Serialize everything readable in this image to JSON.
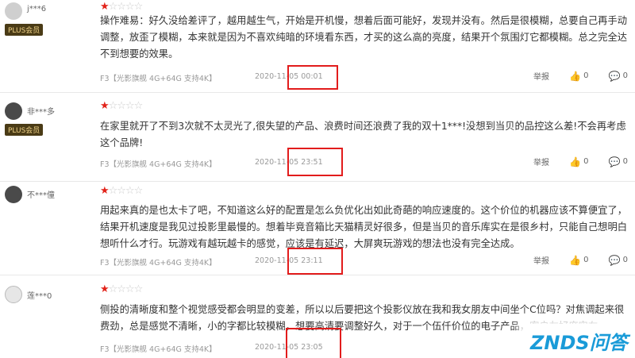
{
  "reviews": [
    {
      "user": "j***6",
      "badge": "PLUS会员",
      "stars_filled": 1,
      "stars_total": 5,
      "content": "操作难易：好久没给差评了，越用越生气，开始是开机慢，想着后面可能好，发现并没有。然后是很模糊，总要自己再手动调整，放歪了模糊，本来就是因为不喜欢纯暗的环境看东西，才买的这么高的亮度，结果开个氛围灯它都模糊。总之完全达不到想要的效果。",
      "product": "F3【光影旗舰 4G+64G 支持4K】",
      "date": "2020-11-05 00:01",
      "report": "举报",
      "likes": "0",
      "replies": "0"
    },
    {
      "user": "非***多",
      "badge": "PLUS会员",
      "stars_filled": 1,
      "stars_total": 5,
      "content": "在家里就开了不到3次就不太灵光了,很失望的产品、浪费时间还浪费了我的双十1***!没想到当贝的品控这么差!不会再考虑这个品牌!",
      "product": "F3【光影旗舰 4G+64G 支持4K】",
      "date": "2020-11-05 23:51",
      "report": "举报",
      "likes": "0",
      "replies": "0"
    },
    {
      "user": "不***僮",
      "badge": "",
      "stars_filled": 1,
      "stars_total": 5,
      "content": "用起来真的是也太卡了吧，不知道这么好的配置是怎么负优化出如此奇葩的响应速度的。这个价位的机器应该不算便宜了，结果开机速度是我见过投影里最慢的。想着毕竟音箱比天猫精灵好很多，但是当贝的音乐库实在是很乡村，只能自己想明白想听什么才行。玩游戏有越玩越卡的感觉，应该是有延迟，大屏爽玩游戏的想法也没有完全达成。",
      "product": "F3【光影旗舰 4G+64G 支持4K】",
      "date": "2020-11-05 23:11",
      "report": "举报",
      "likes": "0",
      "replies": "0"
    },
    {
      "user": "莲***0",
      "badge": "",
      "stars_filled": 1,
      "stars_total": 5,
      "content": "侧投的清晰度和整个视觉感受都会明显的变差，所以以后要把这个投影仪放在我和我女朋友中间坐个C位吗？对焦调起来很费劲，总是感觉不清晰，小的字都比较模糊，想要高清要调整好久，对于一个伍仟价位的电子产品，客户友好度实在",
      "product": "F3【光影旗舰 4G+64G 支持4K】",
      "date": "2020-11-05 23:05",
      "report": "",
      "likes": "",
      "replies": ""
    }
  ],
  "watermark": "ZNDS问答",
  "colors": {
    "star_on": "#e2231a",
    "highlight": "#e21c1c",
    "badge_bg": "#4a3b16",
    "badge_text": "#f1d48a",
    "watermark": "#1a9bd8"
  },
  "icons": {
    "like": "thumb-up-icon",
    "reply": "comment-icon"
  }
}
